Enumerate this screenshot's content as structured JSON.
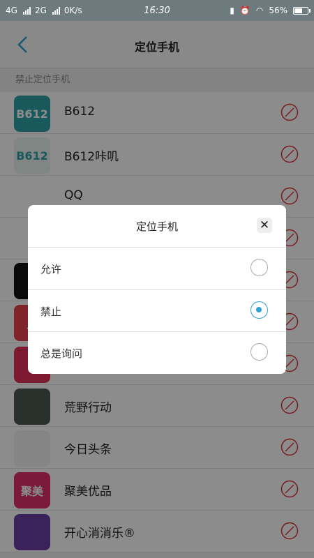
{
  "status_bar": {
    "network1": "4G",
    "network2": "2G",
    "speed": "0K/s",
    "time": "16:30",
    "battery": "56%"
  },
  "header": {
    "title": "定位手机"
  },
  "section_label": "禁止定位手机",
  "apps": [
    {
      "name": "B612",
      "icon": "b612-icon",
      "bg": "#2ea3a8",
      "text": "B612"
    },
    {
      "name": "B612咔叽",
      "icon": "b612-kaji-icon",
      "bg": "#e9f4f1",
      "text": "B612"
    },
    {
      "name": "QQ",
      "icon": "qq-icon",
      "bg": "#ffffff",
      "text": ""
    },
    {
      "name": "",
      "icon": "app-icon",
      "bg": "#ffffff",
      "text": ""
    },
    {
      "name": "",
      "icon": "app-icon",
      "bg": "#111111",
      "text": ""
    },
    {
      "name": "",
      "icon": "app-icon",
      "bg": "#e8434a",
      "text": "贝"
    },
    {
      "name": "",
      "icon": "app-icon",
      "bg": "#e3305c",
      "text": ""
    },
    {
      "name": "荒野行动",
      "icon": "game-icon",
      "bg": "#4e5a52",
      "text": ""
    },
    {
      "name": "今日头条",
      "icon": "toutiao-icon",
      "bg": "#f2f2f2",
      "text": ""
    },
    {
      "name": "聚美优品",
      "icon": "jumei-icon",
      "bg": "#e0306a",
      "text": "聚美"
    },
    {
      "name": "开心消消乐®",
      "icon": "xiaoxiaole-icon",
      "bg": "#6b3fa6",
      "text": ""
    }
  ],
  "dialog": {
    "title": "定位手机",
    "options": [
      {
        "label": "允许",
        "selected": false
      },
      {
        "label": "禁止",
        "selected": true
      },
      {
        "label": "总是询问",
        "selected": false
      }
    ]
  },
  "colors": {
    "accent": "#2ea1d9",
    "deny": "#d9363e"
  }
}
